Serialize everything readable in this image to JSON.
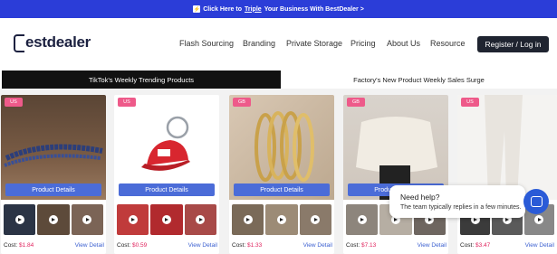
{
  "promo": {
    "before": "Click Here to ",
    "link": "Triple",
    "after": " Your Business With BestDealer >"
  },
  "logo": {
    "text": "estdealer"
  },
  "nav": {
    "items": [
      "Flash Sourcing",
      "Branding",
      "Private Storage",
      "Pricing",
      "About Us",
      "Resource"
    ],
    "login": "Register / Log in"
  },
  "tabs": {
    "active": "TikTok's Weekly Trending Products",
    "inactive": "Factory's New Product Weekly Sales Surge"
  },
  "cards": [
    {
      "badge": "US",
      "cost_label": "Cost:",
      "cost": "$1.84",
      "view": "View Detail",
      "button": "Product Details"
    },
    {
      "badge": "US",
      "cost_label": "Cost:",
      "cost": "$0.59",
      "view": "View Detail",
      "button": "Product Details"
    },
    {
      "badge": "GB",
      "cost_label": "Cost:",
      "cost": "$1.33",
      "view": "View Detail",
      "button": "Product Details"
    },
    {
      "badge": "GB",
      "cost_label": "Cost:",
      "cost": "$7.13",
      "view": "View Detail",
      "button": "Product Details"
    },
    {
      "badge": "US",
      "cost_label": "Cost:",
      "cost": "$3.47",
      "view": "View Detail",
      "button": "Product Details"
    }
  ],
  "chat": {
    "title": "Need help?",
    "subtitle": "The team typically replies in a few minutes."
  },
  "colors": {
    "promo_bg": "#2b3dd8",
    "badge_us": "#ee5a8a",
    "button_blue": "#4b6cd8",
    "cost_red": "#e0245e",
    "chat_blue": "#2a5bd7"
  }
}
